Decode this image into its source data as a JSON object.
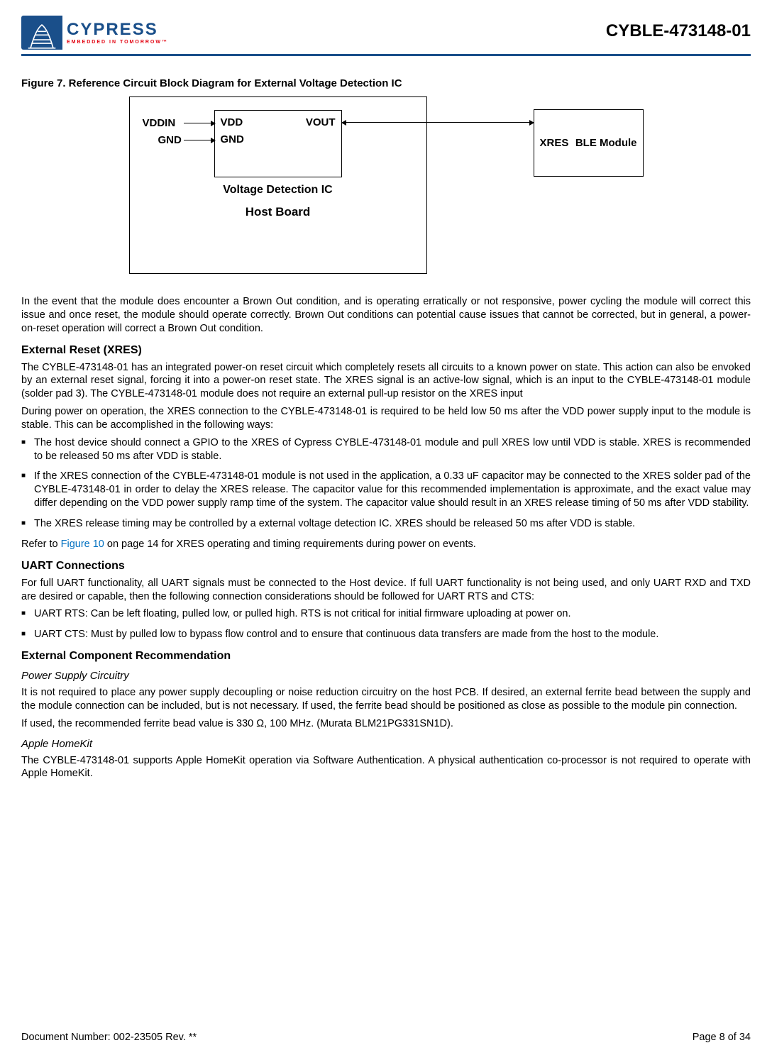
{
  "header": {
    "logo_line1": "CYPRESS",
    "logo_line2": "EMBEDDED IN TOMORROW™",
    "part_number": "CYBLE-473148-01"
  },
  "figure": {
    "caption": "Figure 7.  Reference Circuit Block Diagram for External Voltage Detection IC",
    "vddin": "VDDIN",
    "gnd_in": "GND",
    "vdd": "VDD",
    "gnd": "GND",
    "vout": "VOUT",
    "vd_label": "Voltage Detection IC",
    "host_board": "Host Board",
    "xres": "XRES",
    "ble": "BLE Module"
  },
  "para1": "In the event that the module does encounter a Brown Out condition, and is operating erratically or not responsive, power cycling the module will correct this issue and once reset, the module should operate correctly. Brown Out conditions can potential cause issues that cannot be corrected, but in general, a power-on-reset operation will correct a Brown Out condition.",
  "xres_section": {
    "heading": "External Reset (XRES)",
    "p1": "The CYBLE-473148-01 has an integrated power-on reset circuit which completely resets all circuits to a known power on state. This action can also be envoked by an external reset signal, forcing it into a power-on reset state. The XRES signal is an active-low signal, which is an input to the CYBLE-473148-01 module (solder pad 3). The CYBLE-473148-01 module does not require an external pull-up resistor on the XRES input",
    "p2": "During power on operation, the XRES connection to the CYBLE-473148-01 is required to be held low 50 ms after the VDD power supply input to the module is stable. This can be accomplished in the following ways:",
    "bullets": [
      "The host device should connect a GPIO to the XRES of Cypress CYBLE-473148-01 module and pull XRES low until VDD is stable. XRES is recommended to be released 50 ms after VDD is stable.",
      "If the XRES connection of the CYBLE-473148-01 module is not used in the application, a 0.33 uF capacitor may be connected to the XRES solder pad of the CYBLE-473148-01 in order to delay the XRES release. The capacitor value for this recommended implementation is approximate, and the exact value may differ depending on the VDD power supply ramp time of the system. The capacitor value should result in an XRES release timing of 50 ms after VDD stability.",
      "The XRES release timing may be controlled by a external voltage detection IC. XRES should be released 50 ms after VDD is stable."
    ],
    "p3_pre": "Refer to ",
    "p3_link": "Figure 10",
    "p3_post": " on page 14 for XRES operating and timing requirements during power on events."
  },
  "uart_section": {
    "heading": "UART Connections",
    "p1": "For full UART functionality, all UART signals must be connected to the Host device. If full UART functionality is not being used, and only UART RXD and TXD are desired or capable, then the following connection considerations should be followed for UART RTS and CTS:",
    "bullets": [
      "UART RTS: Can be left floating, pulled low, or pulled high. RTS is not critical for initial firmware uploading at power on.",
      "UART CTS: Must by pulled low to bypass flow control and to ensure that continuous data transfers are made from the host to the module."
    ]
  },
  "ext_comp_section": {
    "heading": "External Component Recommendation",
    "sub1": "Power Supply Circuitry",
    "p1": "It is not required to place any power supply decoupling or noise reduction circuitry on the host PCB. If desired, an external ferrite bead between the supply and the module connection can be included, but is not necessary. If used, the ferrite bead should be positioned as close as possible to the module pin connection.",
    "p2": "If used, the recommended ferrite bead value is 330 Ω, 100 MHz. (Murata BLM21PG331SN1D).",
    "sub2": "Apple HomeKit",
    "p3": "The CYBLE-473148-01 supports Apple HomeKit operation via Software Authentication. A physical authentication co-processor is not required to operate with Apple HomeKit."
  },
  "footer": {
    "doc_number": "Document Number:  002-23505 Rev. **",
    "page": "Page 8 of 34"
  }
}
